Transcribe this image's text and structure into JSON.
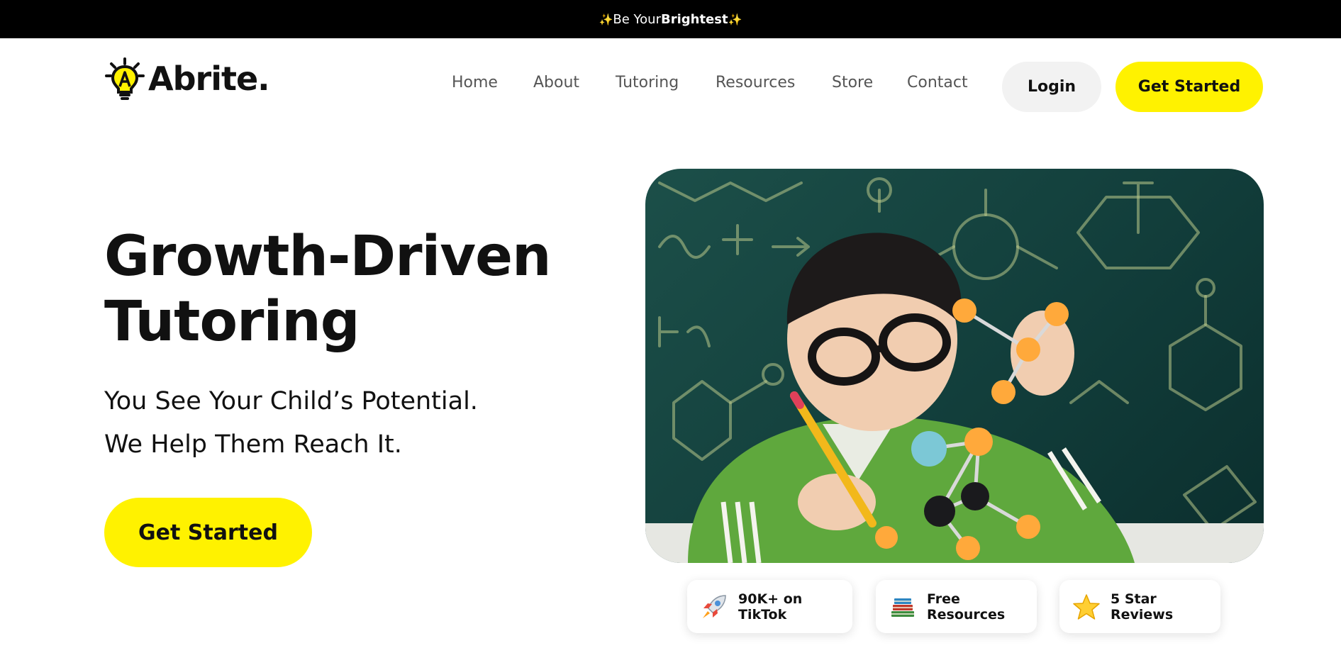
{
  "announcement": {
    "sparkle_left": "✨",
    "prefix": "Be Your ",
    "highlight": "Brightest",
    "sparkle_right": "✨"
  },
  "brand": {
    "name": "Abrite.",
    "logo_icon": "lightbulb-icon"
  },
  "nav": {
    "items": [
      {
        "label": "Home"
      },
      {
        "label": "About"
      },
      {
        "label": "Tutoring"
      },
      {
        "label": "Resources"
      },
      {
        "label": "Store"
      },
      {
        "label": "Contact"
      }
    ],
    "login_label": "Login",
    "get_started_label": "Get Started"
  },
  "hero": {
    "title_line1": "Growth-Driven",
    "title_line2": "Tutoring",
    "subtitle_line1": "You See Your Child’s Potential.",
    "subtitle_line2": "We Help Them Reach It.",
    "cta_label": "Get Started",
    "image_icon": "child-with-molecule-model-photo"
  },
  "badges": [
    {
      "icon": "rocket-icon",
      "label": "90K+ on TikTok"
    },
    {
      "icon": "books-icon",
      "label": "Free Resources"
    },
    {
      "icon": "star-icon",
      "label": "5 Star Reviews"
    }
  ],
  "colors": {
    "accent": "#fff200",
    "topbar": "#000000",
    "login_bg": "#f2f2f2"
  }
}
